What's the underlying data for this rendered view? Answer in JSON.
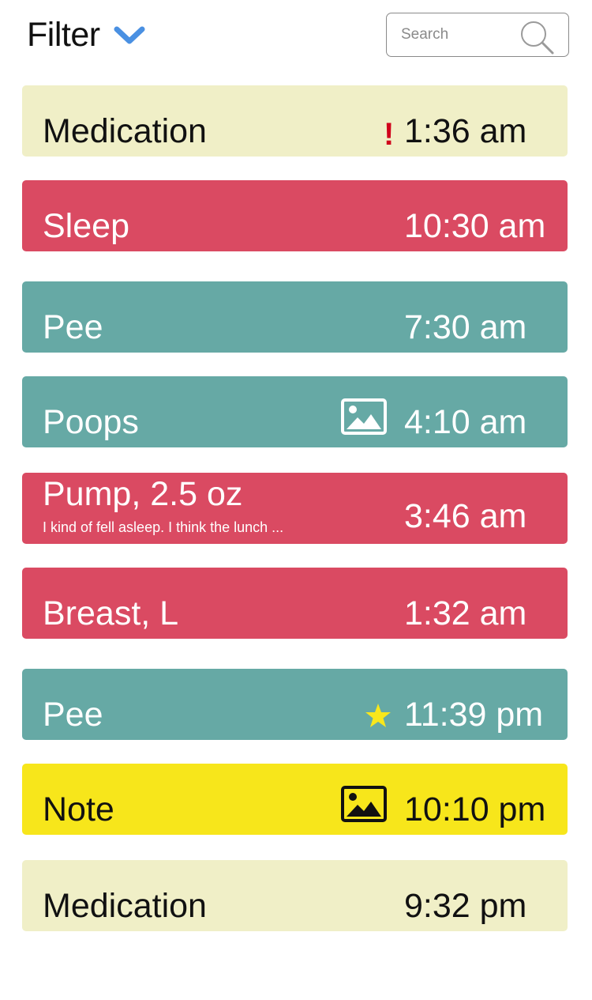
{
  "header": {
    "filter_label": "Filter",
    "search_placeholder": "Search"
  },
  "colors": {
    "medication": "#F0EFC7",
    "sleep_feed": "#DA4A62",
    "diaper": "#66A9A5",
    "note": "#F7E61B",
    "chevron": "#4A90E2",
    "alert": "#D0021B",
    "star": "#F8E71C"
  },
  "entries": [
    {
      "label": "Medication",
      "time": "1:36 am",
      "marker": "exclamation-icon",
      "alert_text": "!"
    },
    {
      "label": "Sleep",
      "time": "10:30 am"
    },
    {
      "label": "Pee",
      "time": "7:30 am"
    },
    {
      "label": "Poops",
      "time": "4:10 am",
      "marker": "image-icon"
    },
    {
      "label": "Pump, 2.5 oz",
      "note": "I kind of fell asleep. I think the lunch ...",
      "time": "3:46 am"
    },
    {
      "label": "Breast, L",
      "time": "1:32 am"
    },
    {
      "label": "Pee",
      "time": "11:39 pm",
      "marker": "star-icon"
    },
    {
      "label": "Note",
      "time": "10:10 pm",
      "marker": "image-icon"
    },
    {
      "label": "Medication",
      "time": "9:32 pm"
    }
  ]
}
